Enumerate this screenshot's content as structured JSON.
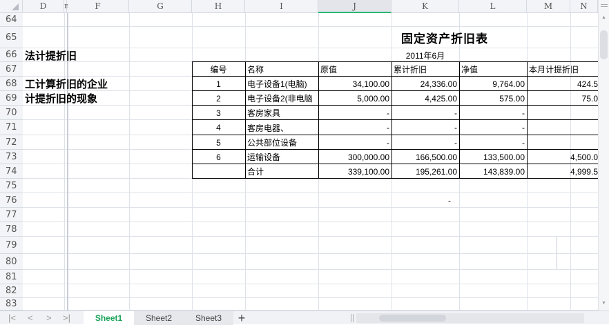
{
  "columns": [
    "D",
    "E",
    "F",
    "G",
    "H",
    "I",
    "J",
    "K",
    "L",
    "M",
    "N"
  ],
  "selected_column": "J",
  "rows": [
    "64",
    "65",
    "66",
    "67",
    "68",
    "69",
    "70",
    "71",
    "72",
    "73",
    "74",
    "75",
    "76",
    "77",
    "78",
    "79",
    "80",
    "81",
    "82",
    "83"
  ],
  "left_text": {
    "r66": "法计提折旧",
    "r68": "工计算折旧的企业",
    "r69": "计提折旧的现象"
  },
  "table": {
    "title": "固定资产折旧表",
    "date": "2011年6月",
    "headers": [
      "编号",
      "名称",
      "原值",
      "累计折旧",
      "净值",
      "本月计提折旧"
    ],
    "rows": [
      [
        "1",
        "电子设备1(电脑)",
        "34,100.00",
        "24,336.00",
        "9,764.00",
        "424.5"
      ],
      [
        "2",
        "电子设备2(非电脑",
        "5,000.00",
        "4,425.00",
        "575.00",
        "75.0"
      ],
      [
        "3",
        "客房家具",
        "-",
        "-",
        "-",
        ""
      ],
      [
        "4",
        "客房电器、",
        "-",
        "-",
        "-",
        ""
      ],
      [
        "5",
        "公共部位设备",
        "-",
        "-",
        "-",
        ""
      ],
      [
        "6",
        "运输设备",
        "300,000.00",
        "166,500.00",
        "133,500.00",
        "4,500.0"
      ],
      [
        "",
        "合计",
        "339,100.00",
        "195,261.00",
        "143,839.00",
        "4,999.5"
      ]
    ],
    "r76_k": "-"
  },
  "sheets": [
    "Sheet1",
    "Sheet2",
    "Sheet3"
  ],
  "active_sheet": "Sheet1",
  "add_sheet": "+",
  "nav": [
    "first-icon",
    "prev-icon",
    "next-icon",
    "last-icon"
  ]
}
